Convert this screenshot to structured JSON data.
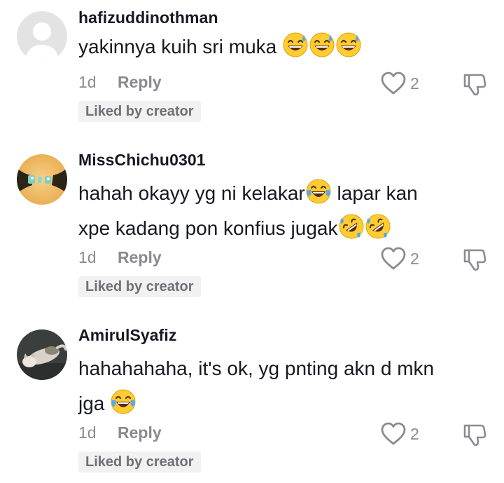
{
  "comments": [
    {
      "username": "hafizuddinothman",
      "avatar": "default-avatar",
      "text_parts": [
        "yakinnya kuih sri muka "
      ],
      "time": "1d",
      "reply_label": "Reply",
      "likes": "2",
      "badge": "Liked by creator"
    },
    {
      "username": "MissChichu0301",
      "avatar": "photo-avatar",
      "text_line1": "hahah okayy yg ni kelakar",
      "text_line1b": " lapar kan",
      "text_line2": "xpe kadang pon konfius jugak",
      "time": "1d",
      "reply_label": "Reply",
      "likes": "2",
      "badge": "Liked by creator"
    },
    {
      "username": "AmirulSyafiz",
      "avatar": "cat-photo-avatar",
      "text_line1": "hahahahaha, it's ok, yg pnting akn d mkn",
      "text_line2": "jga ",
      "time": "1d",
      "reply_label": "Reply",
      "likes": "2",
      "badge": "Liked by creator"
    }
  ],
  "icons": {
    "like": "heart-outline-icon",
    "dislike": "thumbs-down-outline-icon",
    "emoji_sweat_smile": "grinning-face-with-sweat-emoji",
    "emoji_tears_joy": "face-with-tears-of-joy-emoji",
    "emoji_rofl": "rolling-on-floor-laughing-emoji"
  },
  "colors": {
    "text": "#161823",
    "muted": "#8a8b91",
    "badge_bg": "#f1f1f2",
    "badge_text": "#6f7076"
  }
}
